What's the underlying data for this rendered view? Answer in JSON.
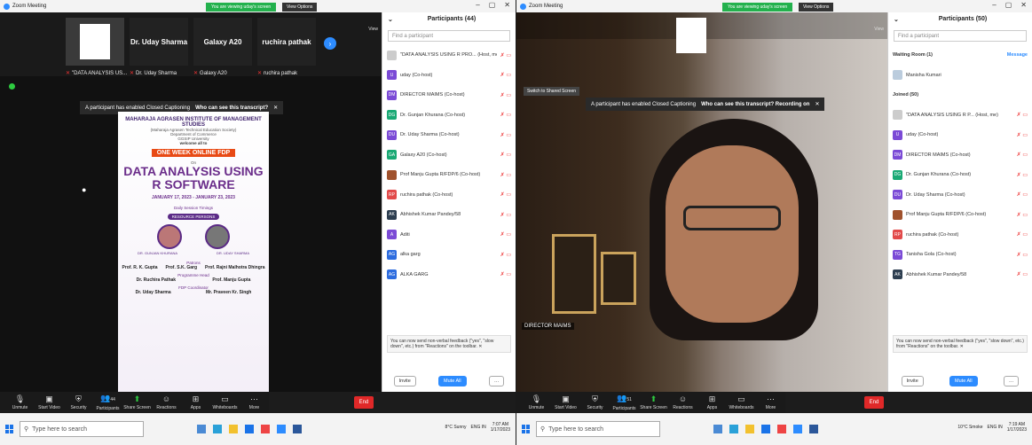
{
  "left": {
    "title": "Zoom Meeting",
    "banner": "You are viewing uday's screen",
    "view_options": "View Options",
    "view_label": "View",
    "tiles": [
      {
        "name": "",
        "label": "\"DATA ANALYSIS US..."
      },
      {
        "name": "Dr. Uday Sharma",
        "label": "Dr. Uday Sharma"
      },
      {
        "name": "Galaxy A20",
        "label": "Galaxy A20"
      },
      {
        "name": "ruchira pathak",
        "label": "ruchira pathak"
      }
    ],
    "cc_notice": "A participant has enabled Closed Captioning",
    "cc_question": "Who can see this transcript?",
    "poster": {
      "institute": "MAHARAJA AGRASEN INSTITUTE OF MANAGEMENT STUDIES",
      "society": "(Maharaja Agrasen Technical Education Society)",
      "dept": "Department of Commerce",
      "univ": "GGSIP University",
      "welcome": "welcome all to",
      "fdp": "ONE WEEK ONLINE FDP",
      "on": "On",
      "title1": "DATA ANALYSIS USING",
      "title2": "R SOFTWARE",
      "dates": "JANUARY 17, 2023 - JANUARY 23, 2023",
      "daily": "Daily Session Timings",
      "resource": "RESOURCE PERSONS",
      "rp1": "DR. GUNJAN KHURANA",
      "rp2": "DR. UDAY SHARMA",
      "patrons": "Patrons",
      "p1": "Prof. R. K. Gupta",
      "p2": "Prof. S.K. Garg",
      "p3": "Prof. Rajni Malhotra Dhingra",
      "convenor": "Programme Head",
      "c1": "Dr. Ruchira Pathak",
      "c2": "Prof. Manju Gupta",
      "coord": "FDP Coordinator",
      "c3": "Dr. Uday Sharma",
      "c4": "Mr. Praveen Kr. Singh"
    },
    "toolbar": [
      {
        "icon": "mic-muted-icon",
        "label": "Unmute"
      },
      {
        "icon": "video-off-icon",
        "label": "Start Video"
      },
      {
        "icon": "security-icon",
        "label": "Security"
      },
      {
        "icon": "participants-icon",
        "label": "Participants",
        "count": "44"
      },
      {
        "icon": "share-screen-icon",
        "label": "Share Screen"
      },
      {
        "icon": "reactions-icon",
        "label": "Reactions"
      },
      {
        "icon": "apps-icon",
        "label": "Apps"
      },
      {
        "icon": "whiteboards-icon",
        "label": "Whiteboards"
      },
      {
        "icon": "more-icon",
        "label": "More"
      }
    ],
    "end": "End",
    "panel": {
      "title": "Participants (44)",
      "find": "Find a participant",
      "rows": [
        {
          "name": "\"DATA ANALYSIS USING R PRO... (Host, me)",
          "initials": "",
          "color": "#cccccc"
        },
        {
          "name": "uday (Co-host)",
          "initials": "U",
          "color": "#7b4ad6"
        },
        {
          "name": "DIRECTOR MAIMS (Co-host)",
          "initials": "DM",
          "color": "#7b4ad6"
        },
        {
          "name": "Dr. Gunjan Khurana (Co-host)",
          "initials": "DG",
          "color": "#19a974"
        },
        {
          "name": "Dr. Uday Sharma (Co-host)",
          "initials": "DU",
          "color": "#7b4ad6"
        },
        {
          "name": "Galaxy A20 (Co-host)",
          "initials": "GA",
          "color": "#19a974"
        },
        {
          "name": "Prof Manju Gupta R/FDP/6 (Co-host)",
          "initials": "",
          "color": "#a0522d"
        },
        {
          "name": "ruchira pathak (Co-host)",
          "initials": "RP",
          "color": "#e24a4a"
        },
        {
          "name": "Abhishek Kumar Pandey/58",
          "initials": "AK",
          "color": "#2d3e50"
        },
        {
          "name": "Aditi",
          "initials": "A",
          "color": "#7b4ad6"
        },
        {
          "name": "alka garg",
          "initials": "AG",
          "color": "#2d6cdf"
        },
        {
          "name": "ALKA GARG",
          "initials": "AG",
          "color": "#2d6cdf"
        }
      ],
      "notice": "You can now send non-verbal feedback (\"yes\", \"slow down\", etc.) from \"Reactions\" on the toolbar.",
      "invite": "Invite",
      "mute_all": "Mute All"
    },
    "taskbar": {
      "search": "Type here to search",
      "weather": "8°C Sunny",
      "lang": "ENG IN",
      "time": "7:07 AM",
      "date": "1/17/2023"
    }
  },
  "right": {
    "title": "Zoom Meeting",
    "banner": "You are viewing uday's screen",
    "view_options": "View Options",
    "view_label": "View",
    "switch_shared": "Switch to Shared Screen",
    "cc_notice": "A participant has enabled Closed Captioning",
    "cc_question": "Who can see this transcript? Recording on",
    "speaker": "DIRECTOR MAIMS",
    "toolbar": [
      {
        "icon": "mic-muted-icon",
        "label": "Unmute"
      },
      {
        "icon": "video-off-icon",
        "label": "Start Video"
      },
      {
        "icon": "security-icon",
        "label": "Security"
      },
      {
        "icon": "participants-icon",
        "label": "Participants",
        "count": "51"
      },
      {
        "icon": "share-screen-icon",
        "label": "Share Screen"
      },
      {
        "icon": "reactions-icon",
        "label": "Reactions"
      },
      {
        "icon": "apps-icon",
        "label": "Apps"
      },
      {
        "icon": "whiteboards-icon",
        "label": "Whiteboards"
      },
      {
        "icon": "more-icon",
        "label": "More"
      }
    ],
    "end": "End",
    "panel": {
      "title": "Participants (50)",
      "find": "Find a participant",
      "waiting": "Waiting Room (1)",
      "message": "Message",
      "waiting_name": "Manisha Kumari",
      "joined": "Joined (50)",
      "rows": [
        {
          "name": "\"DATA ANALYSIS USING R P... (Host, me)",
          "initials": "",
          "color": "#cccccc"
        },
        {
          "name": "uday (Co-host)",
          "initials": "U",
          "color": "#7b4ad6"
        },
        {
          "name": "DIRECTOR MAIMS (Co-host)",
          "initials": "DM",
          "color": "#7b4ad6"
        },
        {
          "name": "Dr. Gunjan Khurana (Co-host)",
          "initials": "DG",
          "color": "#19a974"
        },
        {
          "name": "Dr. Uday Sharma (Co-host)",
          "initials": "DU",
          "color": "#7b4ad6"
        },
        {
          "name": "Prof Manju Gupta R/FDP/6 (Co-host)",
          "initials": "",
          "color": "#a0522d"
        },
        {
          "name": "ruchira pathak (Co-host)",
          "initials": "RP",
          "color": "#e24a4a"
        },
        {
          "name": "Tanisha Gola (Co-host)",
          "initials": "TG",
          "color": "#7b4ad6"
        },
        {
          "name": "Abhishek Kumar Pandey/58",
          "initials": "AK",
          "color": "#2d3e50"
        }
      ],
      "notice": "You can now send non-verbal feedback (\"yes\", \"slow down\", etc.) from \"Reactions\" on the toolbar.",
      "invite": "Invite",
      "mute_all": "Mute All"
    },
    "taskbar": {
      "search": "Type here to search",
      "weather": "10°C Smoke",
      "lang": "ENG IN",
      "time": "7:19 AM",
      "date": "1/17/2023"
    }
  }
}
